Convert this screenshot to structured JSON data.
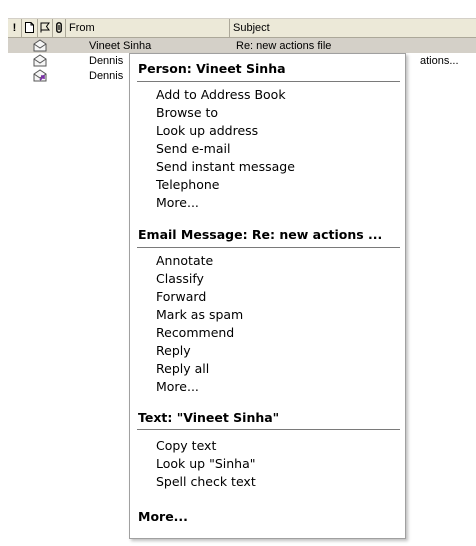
{
  "columns": {
    "importance": "!",
    "icon": "🗋",
    "flag": "⚐",
    "attachment": "0",
    "from": "From",
    "subject": "Subject"
  },
  "messages": [
    {
      "from": "Vineet Sinha",
      "subject": "Re: new actions file",
      "icon": "envelope-open-icon",
      "selected": true
    },
    {
      "from": "Dennis",
      "subject": "ations...",
      "icon": "envelope-open-icon",
      "selected": false
    },
    {
      "from": "Dennis",
      "subject": "",
      "icon": "envelope-reply-icon",
      "selected": false
    }
  ],
  "context_menu": {
    "person": {
      "title": "Person: Vineet Sinha",
      "items": [
        "Add to Address Book",
        "Browse to",
        "Look up address",
        "Send e-mail",
        "Send instant message",
        "Telephone",
        "More..."
      ]
    },
    "email": {
      "title": "Email Message: Re: new actions ...",
      "items": [
        "Annotate",
        "Classify",
        "Forward",
        "Mark as spam",
        "Recommend",
        "Reply",
        "Reply all",
        "More..."
      ]
    },
    "text": {
      "title": "Text: \"Vineet Sinha\"",
      "items": [
        "Copy text",
        "Look up \"Sinha\"",
        "Spell check text"
      ]
    },
    "more": "More..."
  },
  "colors": {
    "header_bg": "#ece9d8",
    "selected_row": "#d4d0c8",
    "menu_border": "#a0a0a0"
  }
}
